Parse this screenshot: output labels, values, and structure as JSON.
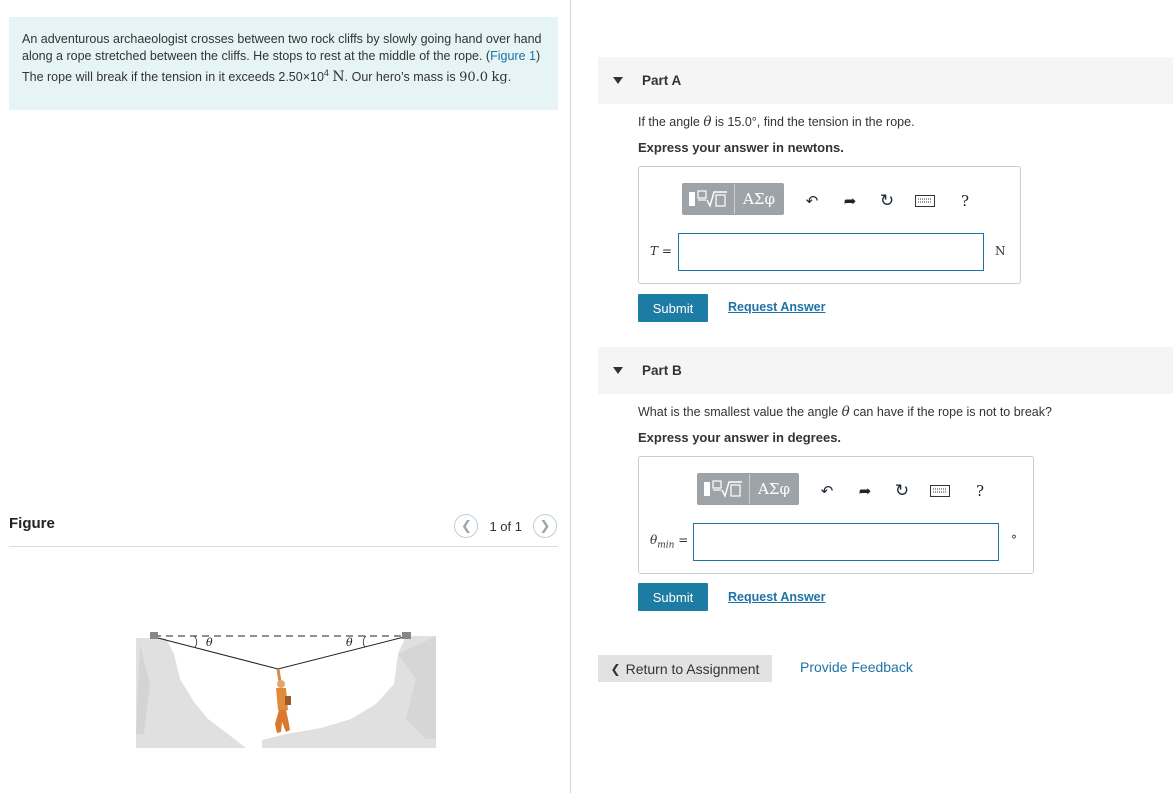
{
  "problem": {
    "text1": "An adventurous archaeologist crosses between two rock cliffs by slowly going hand over hand along a rope stretched between the cliffs. He stops to rest at the middle of the rope. (",
    "figure_link": "Figure 1",
    "text2": ") The rope will break if the tension in it exceeds 2.50×10",
    "tension_exp": "4",
    "tension_unit": "N",
    "text3": ". Our hero’s mass is",
    "mass_value": "90.0",
    "mass_unit": "kg",
    "text4": "."
  },
  "figure": {
    "title": "Figure",
    "pager": "1 of 1",
    "angle_label_left": "θ",
    "angle_label_right": "θ"
  },
  "partA": {
    "title": "Part A",
    "question_pre": "If the angle",
    "theta": "θ",
    "question_post": "is 15.0°, find the tension in the rope.",
    "instruction": "Express your answer in newtons.",
    "greek_label": "ΑΣφ",
    "help": "?",
    "answer_label": "T =",
    "answer_value": "",
    "unit": "N",
    "submit": "Submit",
    "request": "Request Answer"
  },
  "partB": {
    "title": "Part B",
    "question_pre": "What is the smallest value the angle",
    "theta": "θ",
    "question_post": "can have if the rope is not to break?",
    "instruction": "Express your answer in degrees.",
    "greek_label": "ΑΣφ",
    "help": "?",
    "answer_label_sym": "θ",
    "answer_label_sub": "min",
    "answer_label_eq": "=",
    "answer_value": "",
    "unit": "°",
    "submit": "Submit",
    "request": "Request Answer"
  },
  "footer": {
    "return": "Return to Assignment",
    "feedback": "Provide Feedback"
  },
  "colors": {
    "link": "#1d73a6",
    "submit_bg": "#1d7ca3",
    "problem_bg": "#e6f4f5"
  }
}
